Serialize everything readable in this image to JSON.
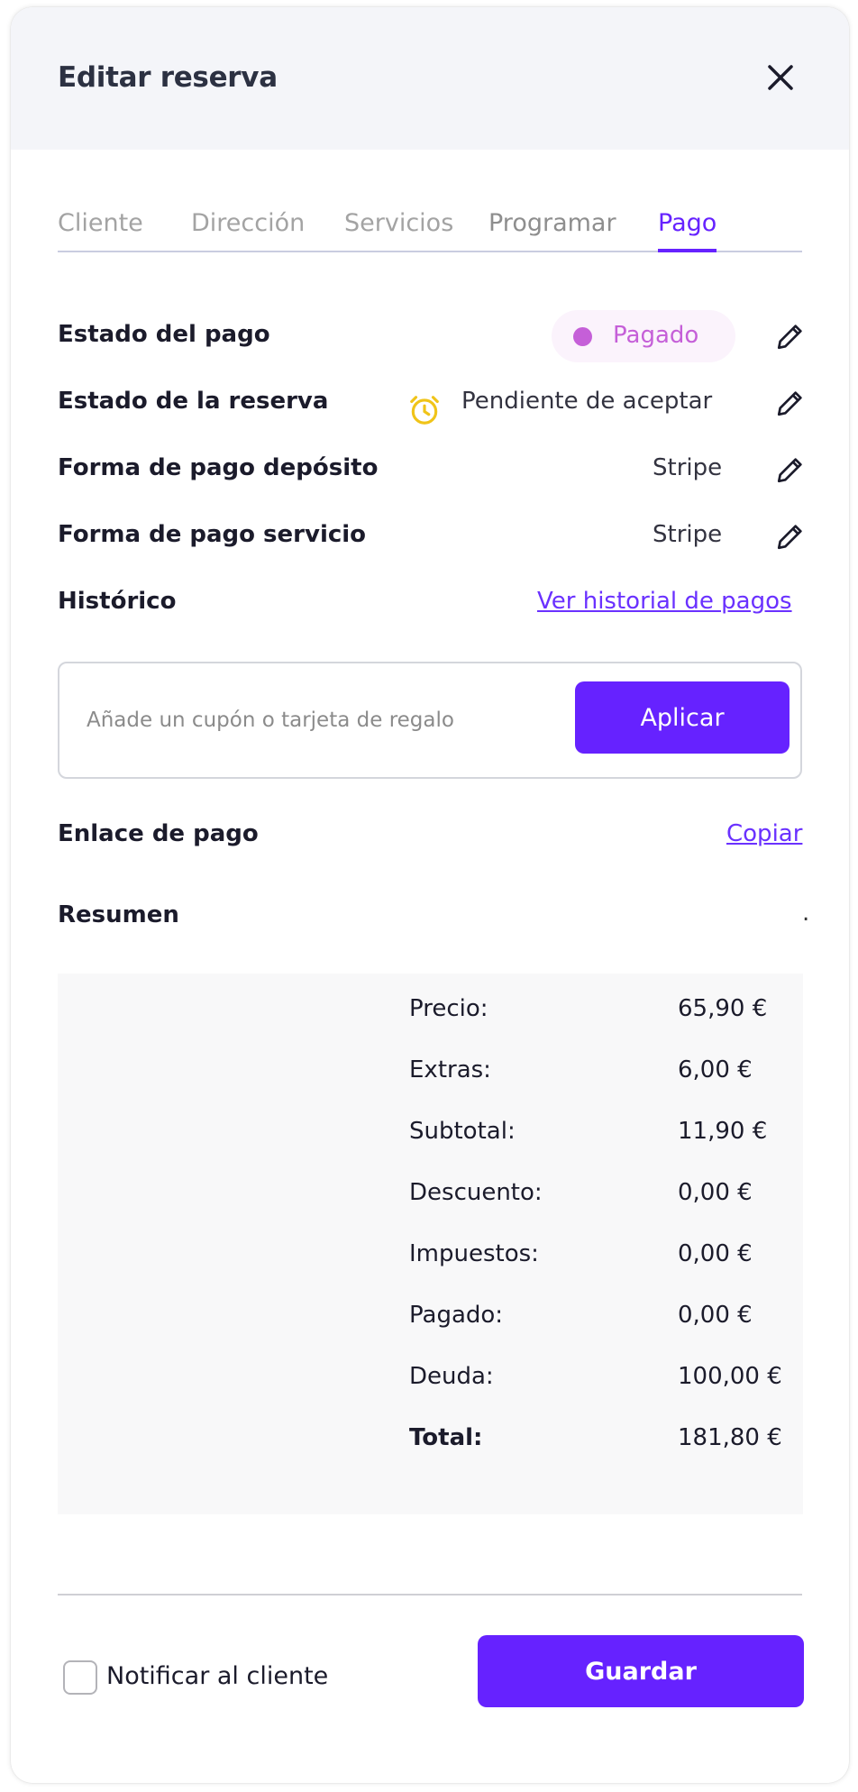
{
  "modal": {
    "title": "Editar reserva"
  },
  "tabs": [
    {
      "label": "Cliente"
    },
    {
      "label": "Dirección"
    },
    {
      "label": "Servicios"
    },
    {
      "label": "Programar"
    },
    {
      "label": "Pago",
      "active": true
    }
  ],
  "payment": {
    "payment_status_label": "Estado del pago",
    "payment_status_value": "Pagado",
    "booking_status_label": "Estado de la reserva",
    "booking_status_value": "Pendiente de aceptar",
    "deposit_method_label": "Forma de pago depósito",
    "deposit_method_value": "Stripe",
    "service_method_label": "Forma de pago servicio",
    "service_method_value": "Stripe",
    "history_label": "Histórico",
    "history_link": "Ver historial de pagos"
  },
  "coupon": {
    "placeholder": "Añade un cupón o tarjeta de regalo",
    "value": "",
    "apply_label": "Aplicar"
  },
  "payment_link": {
    "label": "Enlace de pago",
    "copy_label": "Copiar"
  },
  "summary": {
    "title": "Resumen",
    "trailing": ".",
    "rows": [
      {
        "label": "Precio:",
        "value": "65,90 €"
      },
      {
        "label": "Extras:",
        "value": "6,00 €"
      },
      {
        "label": "Subtotal:",
        "value": "11,90 €"
      },
      {
        "label": "Descuento:",
        "value": "0,00 €"
      },
      {
        "label": "Impuestos:",
        "value": "0,00 €"
      },
      {
        "label": "Pagado:",
        "value": "0,00 €"
      },
      {
        "label": "Deuda:",
        "value": "100,00 €"
      },
      {
        "label": "Total:",
        "value": "181,80 €"
      }
    ]
  },
  "footer": {
    "notify_label": "Notificar al cliente",
    "notify_checked": false,
    "save_label": "Guardar"
  },
  "colors": {
    "accent": "#6622ff",
    "link": "#6a31ff",
    "paid_badge": "#c55fd8",
    "paid_badge_bg": "#fbf3fc",
    "pending_icon": "#f0c419",
    "header_bg": "#f4f5f9",
    "summary_bg": "#f8f8f9"
  },
  "icons": {
    "close": "close-icon",
    "edit": "pencil-icon",
    "pending": "alarm-clock-icon",
    "paid": "status-dot-icon"
  }
}
